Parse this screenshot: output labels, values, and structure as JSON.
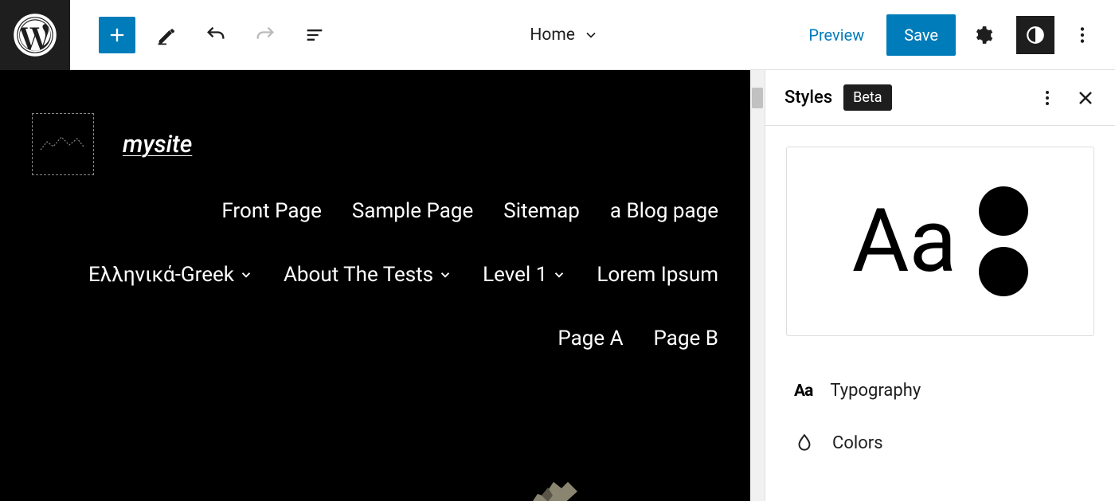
{
  "toolbar": {
    "preview_label": "Preview",
    "save_label": "Save"
  },
  "document": {
    "title": "Home"
  },
  "site": {
    "title": "mysite",
    "nav_rows": [
      [
        "Front Page",
        "Sample Page",
        "Sitemap",
        "a Blog page"
      ],
      [
        {
          "label": "Ελληνικά-Greek",
          "dropdown": true
        },
        {
          "label": "About The Tests",
          "dropdown": true
        },
        {
          "label": "Level 1",
          "dropdown": true
        },
        {
          "label": "Lorem Ipsum",
          "dropdown": false
        }
      ],
      [
        "Page A",
        "Page B"
      ]
    ]
  },
  "sidebar": {
    "title": "Styles",
    "badge": "Beta",
    "preview_text": "Aa",
    "options": [
      {
        "label": "Typography",
        "icon": "aa"
      },
      {
        "label": "Colors",
        "icon": "drop"
      }
    ]
  }
}
